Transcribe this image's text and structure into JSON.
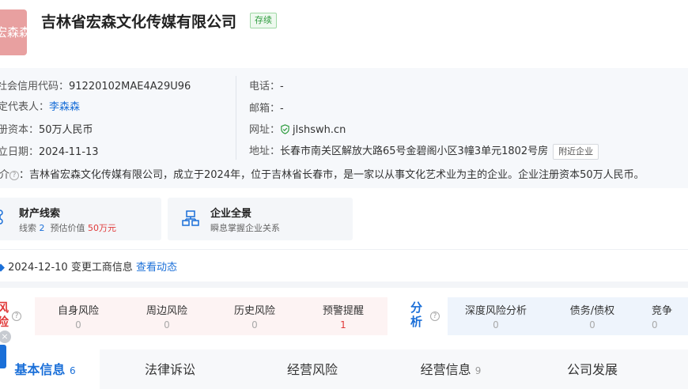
{
  "header": {
    "logo_text": "宏森森",
    "company_name": "吉林省宏森文化传媒有限公司",
    "status": "存续"
  },
  "info": {
    "credit_code_label": "统一社会信用代码：",
    "credit_code": "91220102MAE4A29U96",
    "legal_rep_label": "法定代表人：",
    "legal_rep": "李森森",
    "capital_label": "注册资本：",
    "capital": "50万人民币",
    "founded_label": "成立日期：",
    "founded": "2024-11-13",
    "phone_label": "电话：",
    "phone": "-",
    "email_label": "邮箱：",
    "email": "-",
    "website_label": "网址：",
    "website": "jlshswh.cn",
    "address_label": "地址：",
    "address": "长春市南关区解放大路65号金碧阁小区3幢3单元1802号房",
    "nearby_label": "附近企业",
    "intro_label": "简介",
    "intro": "：吉林省宏森文化传媒有限公司，成立于2024年，位于吉林省长春市，是一家以从事文化艺术业为主的企业。企业注册资本50万人民币。"
  },
  "cards": {
    "property": {
      "title": "财产线索",
      "clue_label": "线索",
      "clue_count": "2",
      "value_label": "预估价值",
      "value": "50万元"
    },
    "panorama": {
      "title": "企业全景",
      "subtitle": "瞬息掌握企业关系"
    }
  },
  "dynamic": {
    "text": "2024-12-10 变更工商信息",
    "link": "查看动态"
  },
  "risk": {
    "title": "风险",
    "items": [
      {
        "label": "自身风险",
        "value": "0"
      },
      {
        "label": "周边风险",
        "value": "0"
      },
      {
        "label": "历史风险",
        "value": "0"
      },
      {
        "label": "预警提醒",
        "value": "1"
      }
    ]
  },
  "analysis": {
    "title": "分析",
    "items": [
      {
        "label": "深度风险分析",
        "value": "0"
      },
      {
        "label": "债务/债权",
        "value": "0"
      },
      {
        "label": "竞争",
        "value": "0"
      }
    ]
  },
  "tabs": [
    {
      "label": "基本信息",
      "count": "6"
    },
    {
      "label": "法律诉讼",
      "count": ""
    },
    {
      "label": "经营风险",
      "count": ""
    },
    {
      "label": "经营信息",
      "count": "9"
    },
    {
      "label": "公司发展",
      "count": ""
    }
  ],
  "colors": {
    "accent": "#1a6fd8",
    "risk": "#e03a3a",
    "status_green": "#2e9c3e"
  }
}
